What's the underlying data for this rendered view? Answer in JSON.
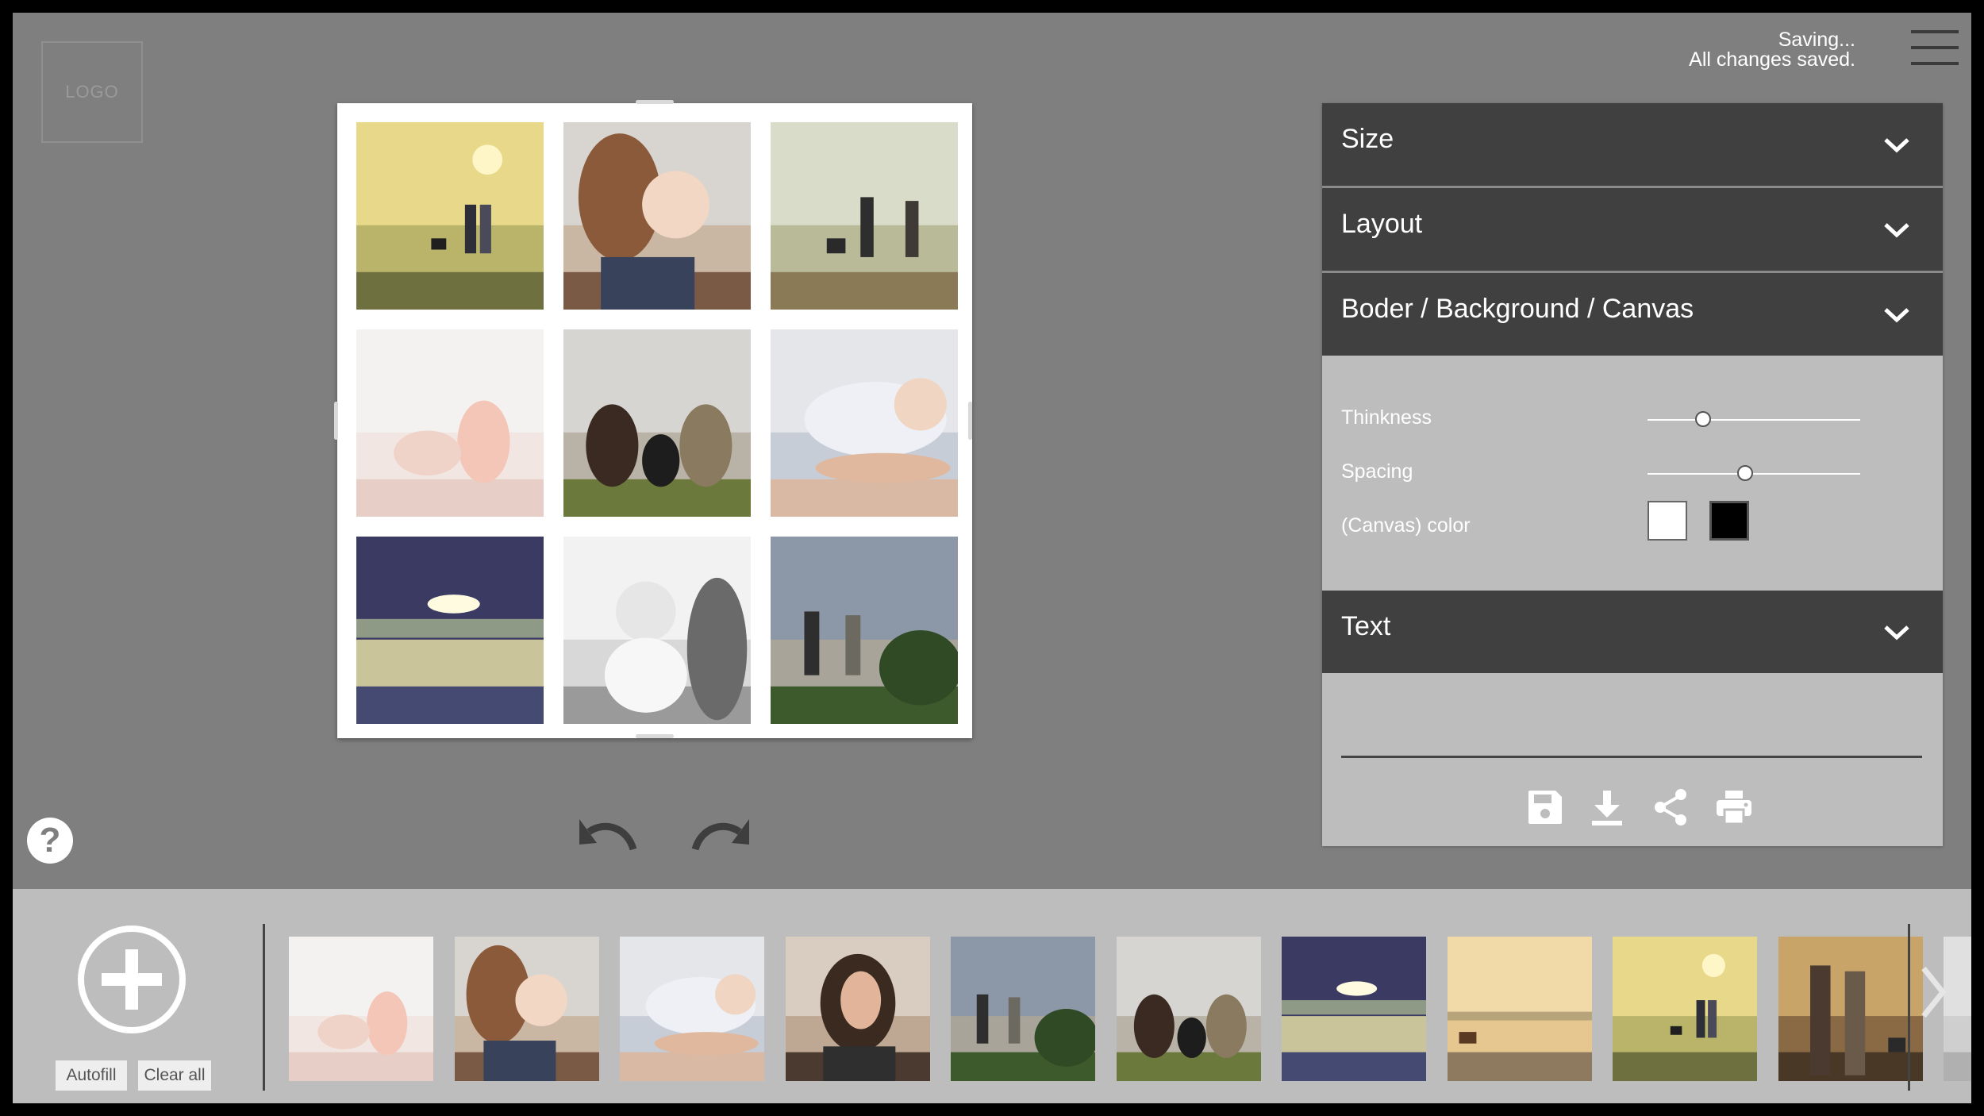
{
  "header": {
    "logo_text": "LOGO",
    "status_line1": "Saving...",
    "status_line2": "All changes saved."
  },
  "collage": {
    "photos": [
      {
        "scene": "couple-dog-hilltop-golden"
      },
      {
        "scene": "mother-holding-baby"
      },
      {
        "scene": "couple-dog-hilltop-mist"
      },
      {
        "scene": "baby-feet"
      },
      {
        "scene": "family-dog-city-view"
      },
      {
        "scene": "baby-held-in-hands"
      },
      {
        "scene": "sunset-over-bay"
      },
      {
        "scene": "baby-black-and-white"
      },
      {
        "scene": "couple-city-hill"
      }
    ]
  },
  "panel": {
    "sections": [
      {
        "title": "Size"
      },
      {
        "title": "Layout"
      },
      {
        "title": "Boder / Background / Canvas"
      },
      {
        "title": "Text"
      }
    ],
    "settings": {
      "thickness_label": "Thinkness",
      "thickness_value": 0.26,
      "spacing_label": "Spacing",
      "spacing_value": 0.46,
      "color_label": "(Canvas) color",
      "colors": [
        "#ffffff",
        "#000000"
      ]
    },
    "actions": [
      "save-icon",
      "download-icon",
      "share-icon",
      "print-icon"
    ]
  },
  "tray": {
    "autofill_label": "Autofill",
    "clear_label": "Clear all",
    "thumbs": [
      {
        "scene": "baby-feet"
      },
      {
        "scene": "mother-holding-baby"
      },
      {
        "scene": "baby-held-in-hands"
      },
      {
        "scene": "woman-portrait"
      },
      {
        "scene": "couple-city-hill"
      },
      {
        "scene": "family-dog-city-view"
      },
      {
        "scene": "sunset-over-bay"
      },
      {
        "scene": "beach-dog-sunset"
      },
      {
        "scene": "couple-dog-hilltop-golden"
      },
      {
        "scene": "couple-dog-walking"
      },
      {
        "scene": "partial-photo"
      }
    ]
  },
  "colors": {
    "app_bg": "#7f7f7f",
    "panel_header": "#404040",
    "panel_body": "#bdbdbd",
    "tray_bg": "#bdbdbd"
  }
}
